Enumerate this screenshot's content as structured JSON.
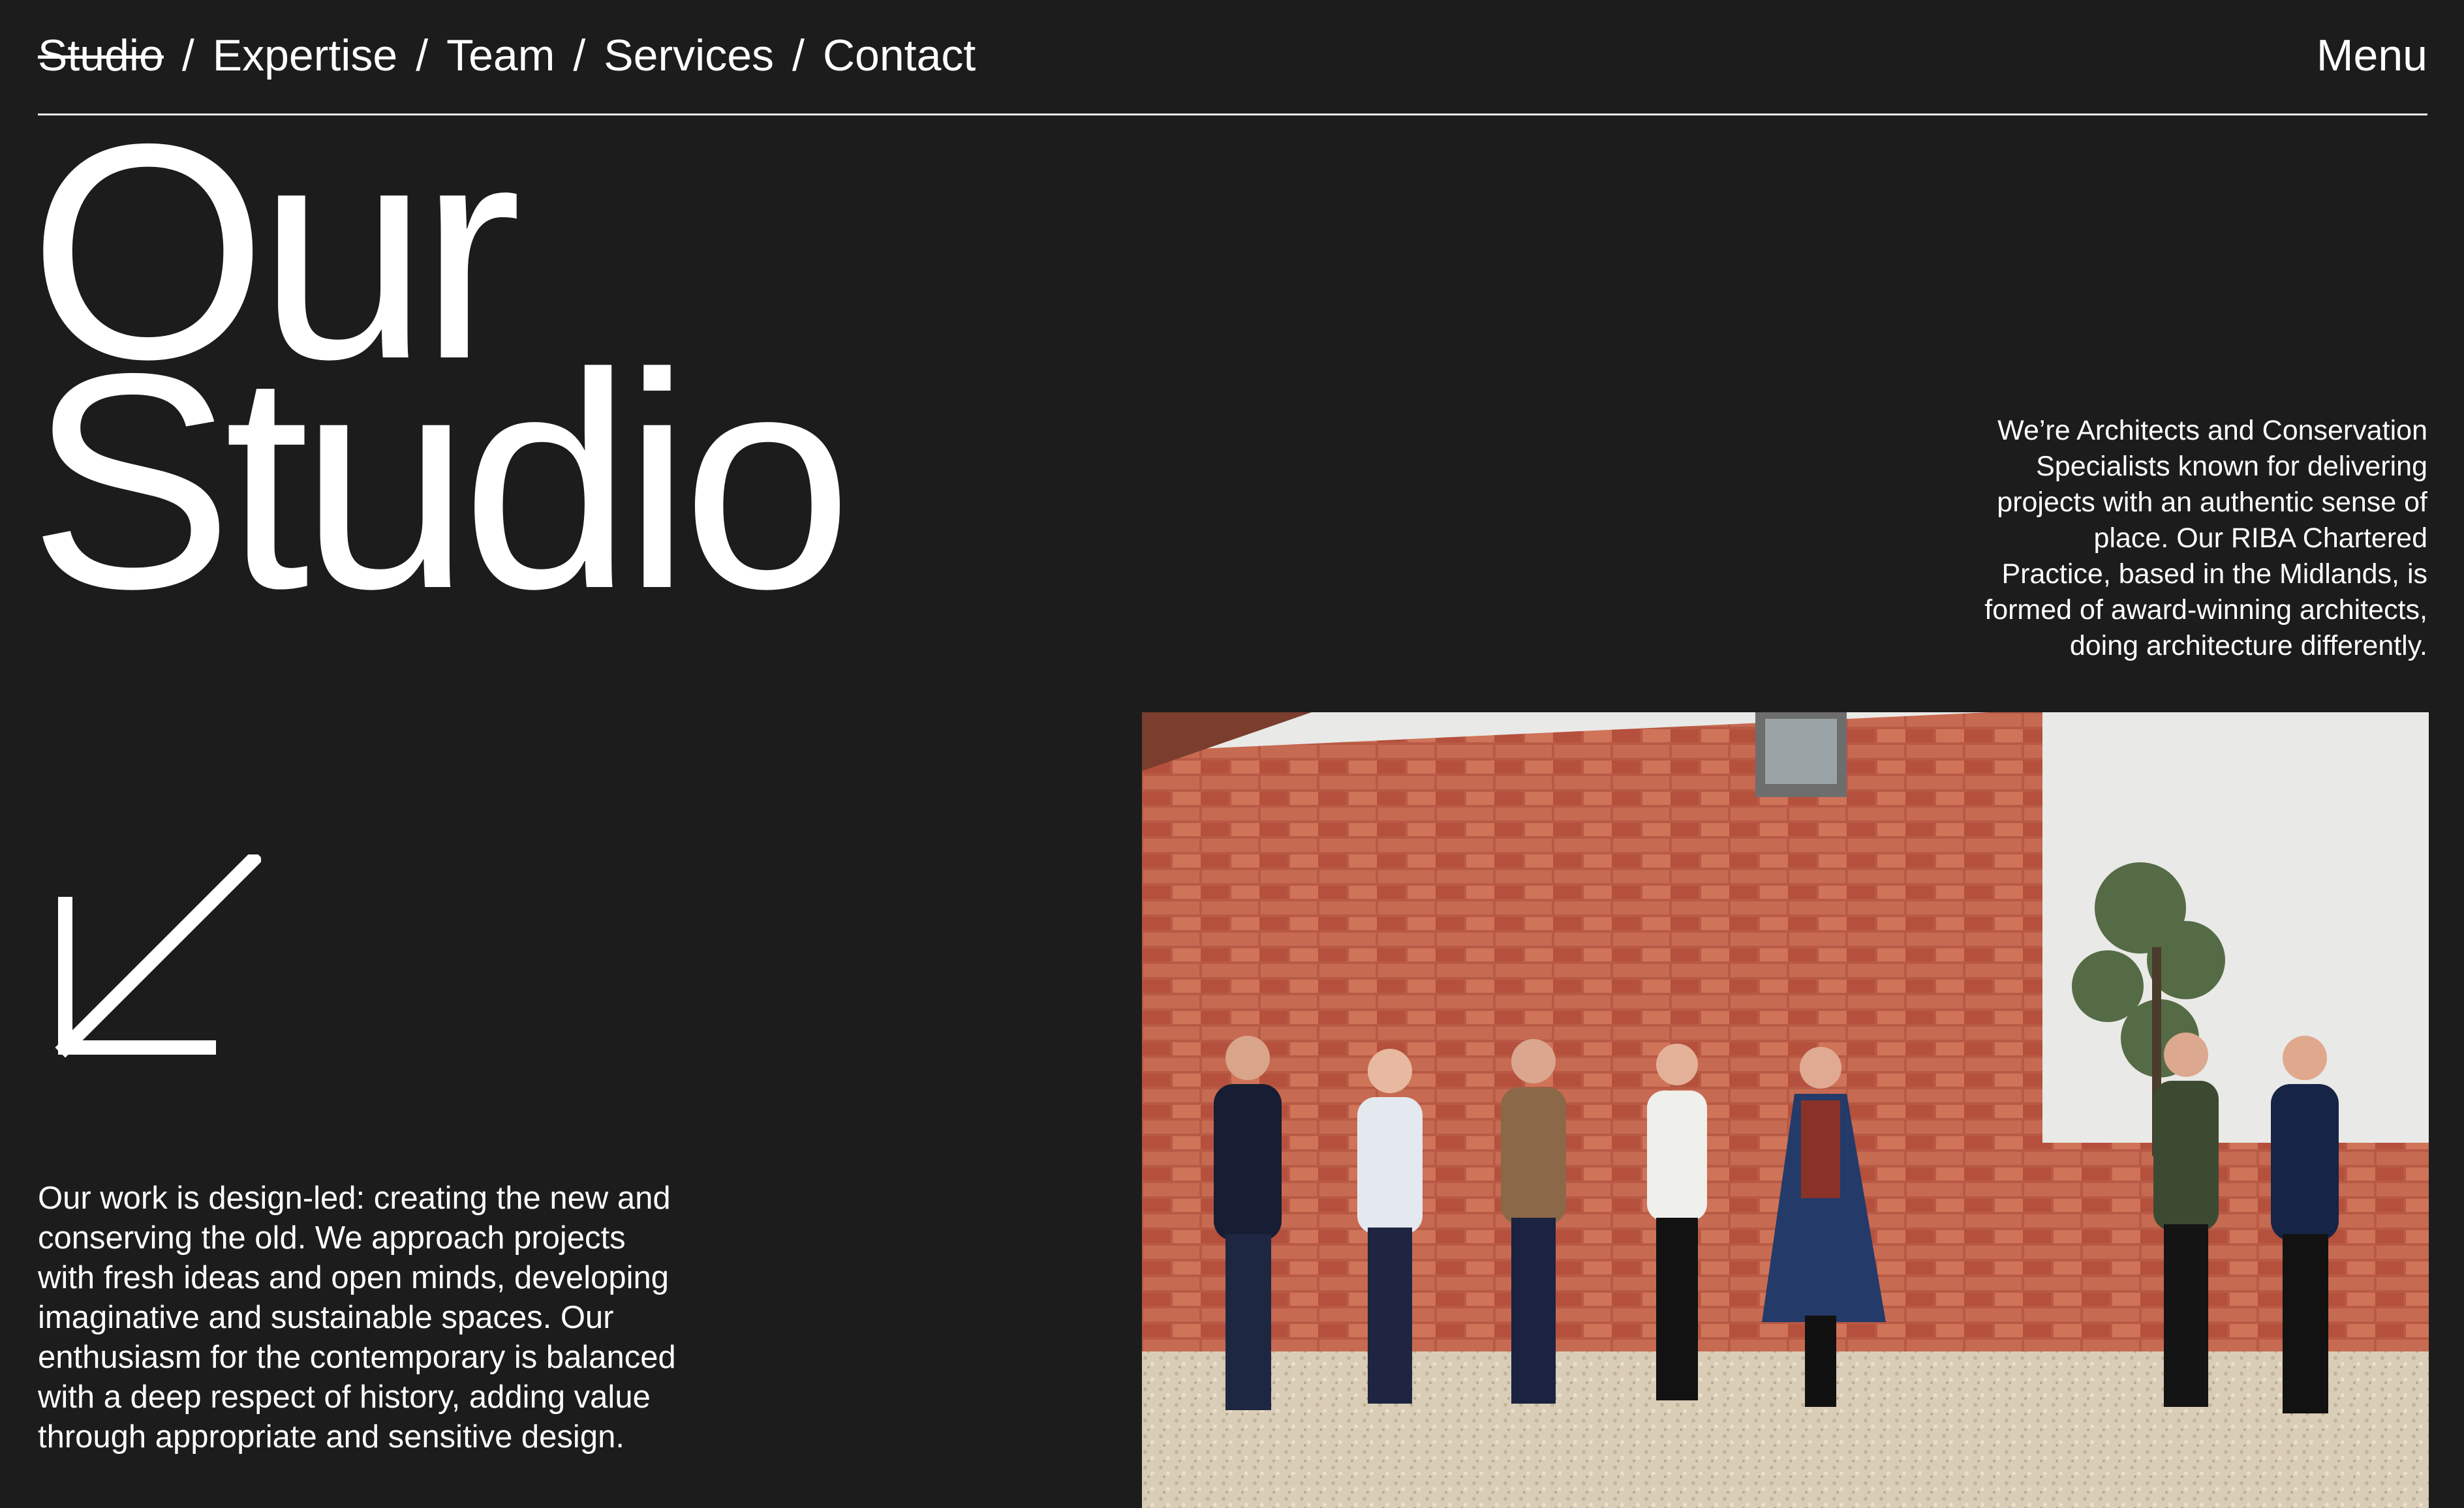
{
  "nav": {
    "items": [
      {
        "label": "Studio",
        "current": true
      },
      {
        "label": "Expertise",
        "current": false
      },
      {
        "label": "Team",
        "current": false
      },
      {
        "label": "Services",
        "current": false
      },
      {
        "label": "Contact",
        "current": false
      }
    ],
    "separator": "/",
    "menu_label": "Menu"
  },
  "hero": {
    "title_line1": "Our",
    "title_line2": "Studio"
  },
  "intro_text": "We’re Architects and Conservation Specialists known for delivering projects with an authentic sense of place. Our RIBA Chartered Practice, based in the Midlands, is formed of award-winning architects, doing architecture differently.",
  "body_text": "Our work is design-led: creating the new and conserving the old.  We approach projects with fresh ideas and open minds, developing imaginative and sustainable spaces. Our enthusiasm for the contemporary is balanced with a deep respect of history, adding value through appropriate and sensitive design.",
  "icons": {
    "scroll_arrow": "arrow-down-left-icon"
  },
  "colors": {
    "background": "#1c1c1c",
    "text": "#ffffff"
  }
}
